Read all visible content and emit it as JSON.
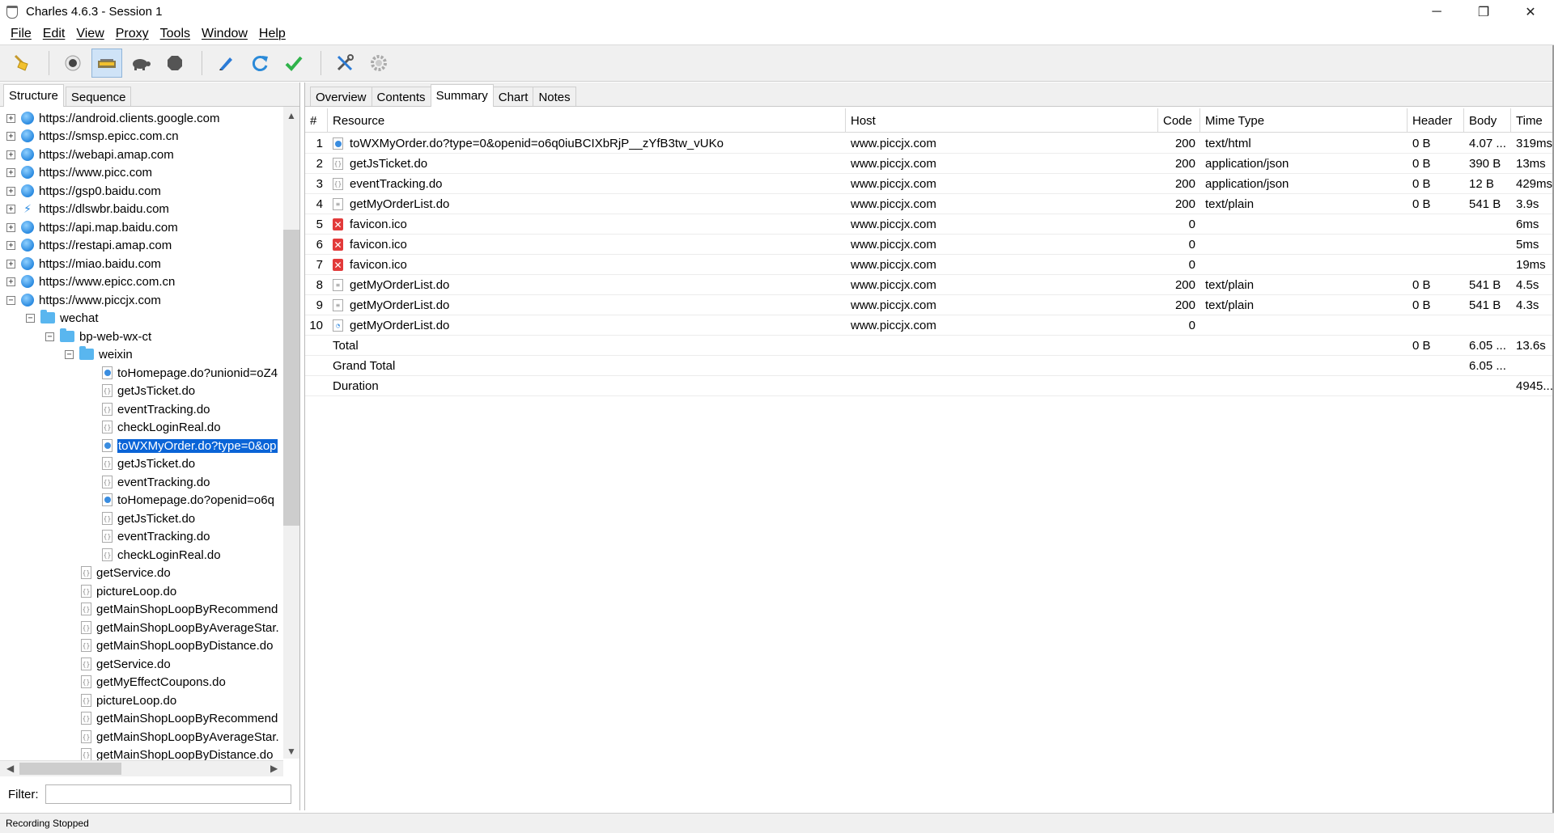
{
  "window": {
    "title": "Charles 4.6.3 - Session 1",
    "controls": {
      "minimize": "─",
      "maximize": "❐",
      "close": "✕"
    }
  },
  "menu": [
    "File",
    "Edit",
    "View",
    "Proxy",
    "Tools",
    "Window",
    "Help"
  ],
  "toolbar": {
    "icons": [
      "broom-icon",
      "record-icon",
      "throttle-icon",
      "turtle-icon",
      "stop-icon",
      "pen-icon",
      "refresh-icon",
      "checkmark-icon",
      "tools-icon",
      "gear-icon"
    ],
    "active": "throttle-icon"
  },
  "left_tabs": [
    "Structure",
    "Sequence"
  ],
  "tree": {
    "hosts": [
      {
        "label": "https://android.clients.google.com",
        "icon": "globe"
      },
      {
        "label": "https://smsp.epicc.com.cn",
        "icon": "globe"
      },
      {
        "label": "https://webapi.amap.com",
        "icon": "globe"
      },
      {
        "label": "https://www.picc.com",
        "icon": "globe"
      },
      {
        "label": "https://gsp0.baidu.com",
        "icon": "globe"
      },
      {
        "label": "https://dlswbr.baidu.com",
        "icon": "bolt"
      },
      {
        "label": "https://api.map.baidu.com",
        "icon": "globe"
      },
      {
        "label": "https://restapi.amap.com",
        "icon": "globe"
      },
      {
        "label": "https://miao.baidu.com",
        "icon": "globe"
      },
      {
        "label": "https://www.epicc.com.cn",
        "icon": "globe"
      },
      {
        "label": "https://www.piccjx.com",
        "icon": "globe"
      }
    ],
    "folders": [
      "wechat",
      "bp-web-wx-ct",
      "weixin"
    ],
    "weixin_items": [
      {
        "label": "toHomepage.do?unionid=oZ4",
        "icon": "dot"
      },
      {
        "label": "getJsTicket.do",
        "icon": "json"
      },
      {
        "label": "eventTracking.do",
        "icon": "json"
      },
      {
        "label": "checkLoginReal.do",
        "icon": "json"
      },
      {
        "label": "toWXMyOrder.do?type=0&op",
        "icon": "dot",
        "selected": true
      },
      {
        "label": "getJsTicket.do",
        "icon": "json"
      },
      {
        "label": "eventTracking.do",
        "icon": "json"
      },
      {
        "label": "toHomepage.do?openid=o6q",
        "icon": "dot"
      },
      {
        "label": "getJsTicket.do",
        "icon": "json"
      },
      {
        "label": "eventTracking.do",
        "icon": "json"
      },
      {
        "label": "checkLoginReal.do",
        "icon": "json"
      }
    ],
    "ctx_items": [
      "getService.do",
      "pictureLoop.do",
      "getMainShopLoopByRecommend",
      "getMainShopLoopByAverageStar.",
      "getMainShopLoopByDistance.do",
      "getService.do",
      "getMyEffectCoupons.do",
      "pictureLoop.do",
      "getMainShopLoopByRecommend",
      "getMainShopLoopByAverageStar.",
      "getMainShopLoopByDistance.do"
    ]
  },
  "filter": {
    "label": "Filter:",
    "value": ""
  },
  "right_tabs": [
    "Overview",
    "Contents",
    "Summary",
    "Chart",
    "Notes"
  ],
  "selected_right_tab": "Summary",
  "table": {
    "columns": [
      "#",
      "Resource",
      "Host",
      "Code",
      "Mime Type",
      "Header",
      "Body",
      "Time"
    ],
    "rows": [
      {
        "n": "1",
        "icon": "dot",
        "resource": "toWXMyOrder.do?type=0&openid=o6q0iuBCIXbRjP__zYfB3tw_vUKo",
        "host": "www.piccjx.com",
        "code": "200",
        "mime": "text/html",
        "header": "0 B",
        "body": "4.07 ...",
        "time": "319ms"
      },
      {
        "n": "2",
        "icon": "json",
        "resource": "getJsTicket.do",
        "host": "www.piccjx.com",
        "code": "200",
        "mime": "application/json",
        "header": "0 B",
        "body": "390 B",
        "time": "13ms"
      },
      {
        "n": "3",
        "icon": "json",
        "resource": "eventTracking.do",
        "host": "www.piccjx.com",
        "code": "200",
        "mime": "application/json",
        "header": "0 B",
        "body": "12 B",
        "time": "429ms"
      },
      {
        "n": "4",
        "icon": "text",
        "resource": "getMyOrderList.do",
        "host": "www.piccjx.com",
        "code": "200",
        "mime": "text/plain",
        "header": "0 B",
        "body": "541 B",
        "time": "3.9s"
      },
      {
        "n": "5",
        "icon": "error",
        "resource": "favicon.ico",
        "host": "www.piccjx.com",
        "code": "0",
        "mime": "",
        "header": "",
        "body": "",
        "time": "6ms"
      },
      {
        "n": "6",
        "icon": "error",
        "resource": "favicon.ico",
        "host": "www.piccjx.com",
        "code": "0",
        "mime": "",
        "header": "",
        "body": "",
        "time": "5ms"
      },
      {
        "n": "7",
        "icon": "error",
        "resource": "favicon.ico",
        "host": "www.piccjx.com",
        "code": "0",
        "mime": "",
        "header": "",
        "body": "",
        "time": "19ms"
      },
      {
        "n": "8",
        "icon": "text",
        "resource": "getMyOrderList.do",
        "host": "www.piccjx.com",
        "code": "200",
        "mime": "text/plain",
        "header": "0 B",
        "body": "541 B",
        "time": "4.5s"
      },
      {
        "n": "9",
        "icon": "text",
        "resource": "getMyOrderList.do",
        "host": "www.piccjx.com",
        "code": "200",
        "mime": "text/plain",
        "header": "0 B",
        "body": "541 B",
        "time": "4.3s"
      },
      {
        "n": "10",
        "icon": "pending",
        "resource": "getMyOrderList.do",
        "host": "www.piccjx.com",
        "code": "0",
        "mime": "",
        "header": "",
        "body": "",
        "time": ""
      }
    ],
    "totals": [
      {
        "label": "Total",
        "header": "0 B",
        "body": "6.05 ...",
        "time": "13.6s"
      },
      {
        "label": "Grand Total",
        "header": "",
        "body": "6.05 ...",
        "time": ""
      },
      {
        "label": "Duration",
        "header": "",
        "body": "",
        "time": "4945...."
      }
    ]
  },
  "status": "Recording Stopped"
}
